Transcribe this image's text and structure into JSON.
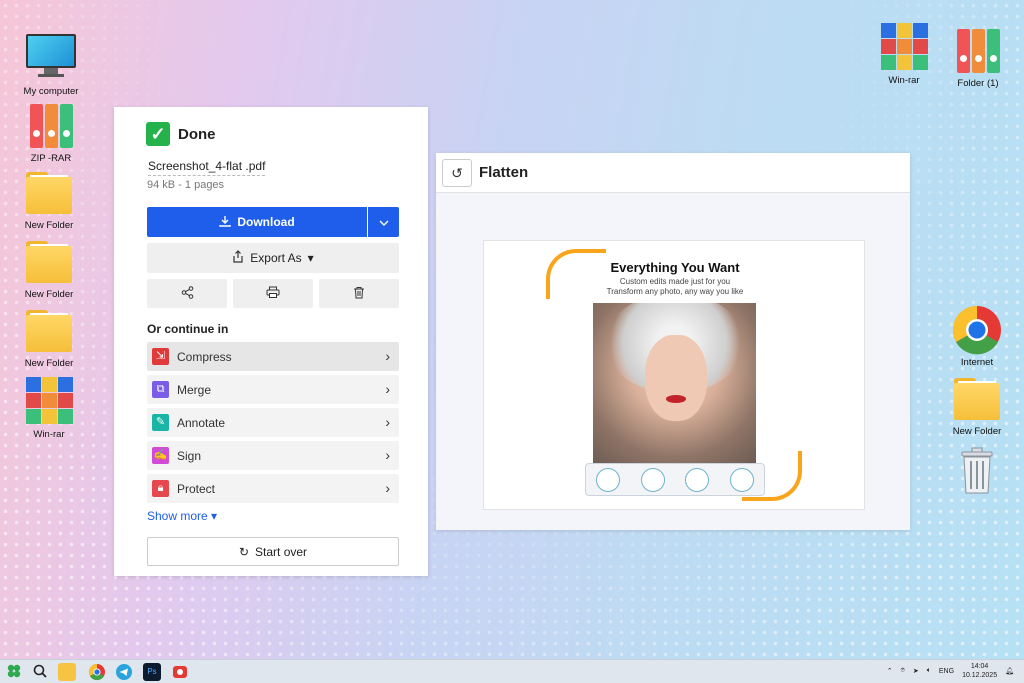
{
  "desktop": {
    "left_icons": [
      {
        "label": "My computer",
        "icon": "monitor-icon"
      },
      {
        "label": "ZIP -RAR",
        "icon": "binders-icon"
      },
      {
        "label": "New Folder",
        "icon": "folder-icon"
      },
      {
        "label": "New Folder",
        "icon": "folder-icon"
      },
      {
        "label": "New Folder",
        "icon": "folder-icon"
      },
      {
        "label": "Win-rar",
        "icon": "winrar-icon"
      }
    ],
    "top_right_icons": [
      {
        "label": "Win-rar",
        "icon": "winrar-icon"
      },
      {
        "label": "Folder (1)",
        "icon": "binders-icon"
      }
    ],
    "right_icons": [
      {
        "label": "Internet",
        "icon": "chrome-icon"
      },
      {
        "label": "New Folder",
        "icon": "folder-icon"
      },
      {
        "label": "",
        "icon": "trash-icon"
      }
    ]
  },
  "panel": {
    "status": "Done",
    "filename": "Screenshot_4-flat .pdf",
    "fileinfo": "94 kB - 1 pages",
    "download_label": "Download",
    "export_label": "Export As",
    "continue_heading": "Or continue in",
    "tools": [
      {
        "label": "Compress",
        "color": "#e03a3a"
      },
      {
        "label": "Merge",
        "color": "#7b5ce6"
      },
      {
        "label": "Annotate",
        "color": "#1bb5a7"
      },
      {
        "label": "Sign",
        "color": "#d24bd6"
      },
      {
        "label": "Protect",
        "color": "#e5484d"
      }
    ],
    "show_more": "Show more",
    "start_over": "Start over"
  },
  "flatten": {
    "title": "Flatten",
    "poster": {
      "heading": "Everything You Want",
      "line1": "Custom edits made just for you",
      "line2": "Transform any photo, any way you like"
    }
  },
  "taskbar": {
    "language": "ENG",
    "time": "14:04",
    "date": "10.12.2025"
  },
  "colors": {
    "accent": "#1e5eea",
    "success": "#26b24a",
    "poster_accent": "#f8a51c"
  }
}
